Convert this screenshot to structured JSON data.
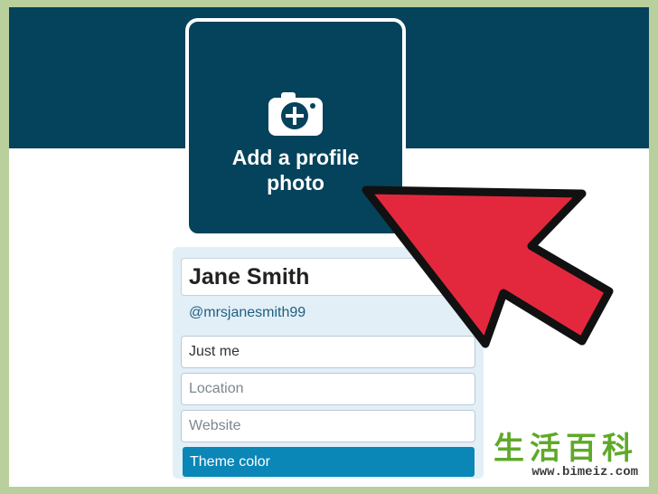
{
  "profile_photo": {
    "label": "Add a profile photo",
    "icon": "camera-plus-icon"
  },
  "profile": {
    "name": "Jane Smith",
    "handle": "@mrsjanesmith99",
    "bio_value": "Just me",
    "location_placeholder": "Location",
    "website_placeholder": "Website",
    "theme_label": "Theme color"
  },
  "colors": {
    "banner": "#05425b",
    "panel": "#e3eff6",
    "theme_button": "#0a86b7",
    "arrow": "#e3283e",
    "outer_border": "#b9cf9c"
  },
  "watermark": {
    "chars": "生活百科",
    "url": "www.bimeiz.com"
  }
}
